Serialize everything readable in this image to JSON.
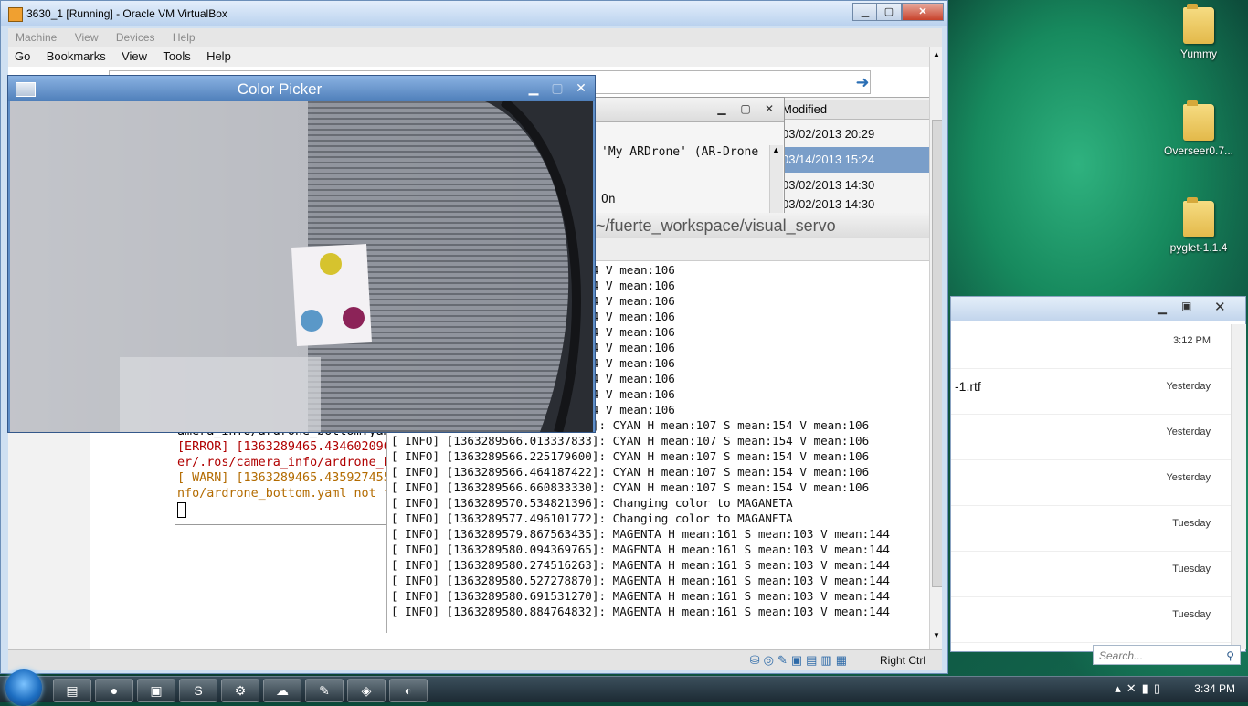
{
  "vbox": {
    "title": "3630_1 [Running] - Oracle VM VirtualBox",
    "menu": [
      "Machine",
      "View",
      "Devices",
      "Help"
    ],
    "status_hostkey": "Right Ctrl"
  },
  "guest_menu": [
    "Go",
    "Bookmarks",
    "View",
    "Tools",
    "Help"
  ],
  "file_manager": {
    "column_header": "Modified",
    "rows": [
      "03/02/2013 20:29",
      "03/14/2013 15:24",
      "03/02/2013 14:30",
      "03/02/2013 14:30"
    ]
  },
  "dialog": {
    "text": "'My ARDrone' (AR-Drone",
    "text2": "On"
  },
  "terminal": {
    "title": "~/fuerte_workspace/visual_servo",
    "lines": [
      "3]: CYAN H mean:107 S mean:154 V mean:106",
      "3]: CYAN H mean:107 S mean:154 V mean:106",
      "3]: CYAN H mean:107 S mean:154 V mean:106",
      "5]: CYAN H mean:107 S mean:154 V mean:106",
      "9]: CYAN H mean:107 S mean:154 V mean:106",
      "2]: CYAN H mean:107 S mean:154 V mean:106",
      "3]: CYAN H mean:107 S mean:154 V mean:106",
      "9]: CYAN H mean:107 S mean:154 V mean:106",
      "3]: CYAN H mean:107 S mean:154 V mean:106",
      "9]: CYAN H mean:107 S mean:154 V mean:106",
      "[ INFO] [1363289565.802903286]: CYAN H mean:107 S mean:154 V mean:106",
      "[ INFO] [1363289566.013337833]: CYAN H mean:107 S mean:154 V mean:106",
      "[ INFO] [1363289566.225179600]: CYAN H mean:107 S mean:154 V mean:106",
      "[ INFO] [1363289566.464187422]: CYAN H mean:107 S mean:154 V mean:106",
      "[ INFO] [1363289566.660833330]: CYAN H mean:107 S mean:154 V mean:106",
      "[ INFO] [1363289570.534821396]: Changing color to MAGANETA",
      "[ INFO] [1363289577.496101772]: Changing color to MAGANETA",
      "[ INFO] [1363289579.867563435]: MAGENTA H mean:161 S mean:103 V mean:144",
      "[ INFO] [1363289580.094369765]: MAGENTA H mean:161 S mean:103 V mean:144",
      "[ INFO] [1363289580.274516263]: MAGENTA H mean:161 S mean:103 V mean:144",
      "[ INFO] [1363289580.527278870]: MAGENTA H mean:161 S mean:103 V mean:144",
      "[ INFO] [1363289580.691531270]: MAGENTA H mean:161 S mean:103 V mean:144",
      "[ INFO] [1363289580.884764832]: MAGENTA H mean:161 S mean:103 V mean:144"
    ]
  },
  "terminal2": {
    "line1": "amera_info/ardrone_bottom.yaml",
    "line2": "[ERROR] [1363289465.434602090",
    "line3": "er/.ros/camera_info/ardrone_b",
    "line4": "[ WARN] [1363289465.435927455",
    "line5": "nfo/ardrone_bottom.yaml not f"
  },
  "picker": {
    "title": "Color Picker",
    "dots": [
      {
        "name": "yellow",
        "color": "#d6c32e"
      },
      {
        "name": "cyan",
        "color": "#5a98c8"
      },
      {
        "name": "magenta",
        "color": "#8c2358"
      }
    ]
  },
  "desktop_icons": [
    "Yummy",
    "Overseer0.7...",
    "pyglet-1.1.4"
  ],
  "explorer": {
    "rows": [
      {
        "name": "",
        "date": "3:12 PM"
      },
      {
        "name": "-1.rtf",
        "date": "Yesterday"
      },
      {
        "name": "",
        "date": "Yesterday"
      },
      {
        "name": "",
        "date": "Yesterday"
      },
      {
        "name": "",
        "date": "Tuesday"
      },
      {
        "name": "",
        "date": "Tuesday"
      },
      {
        "name": "",
        "date": "Tuesday"
      }
    ],
    "search_placeholder": "Search..."
  },
  "taskbar": {
    "clock": "3:34 PM"
  }
}
